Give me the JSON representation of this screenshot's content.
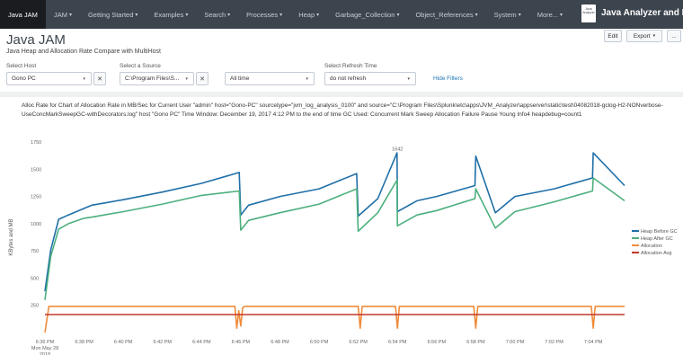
{
  "nav": {
    "items": [
      {
        "label": "Java JAM",
        "caret": ""
      },
      {
        "label": "JAM",
        "caret": "▾"
      },
      {
        "label": "Getting Started",
        "caret": "▾"
      },
      {
        "label": "Examples",
        "caret": "▾"
      },
      {
        "label": "Search",
        "caret": "▾"
      },
      {
        "label": "Processes",
        "caret": "▾"
      },
      {
        "label": "Heap",
        "caret": "▾"
      },
      {
        "label": "Garbage_Collection",
        "caret": "▾"
      },
      {
        "label": "Object_References",
        "caret": "▾"
      },
      {
        "label": "System",
        "caret": "▾"
      },
      {
        "label": "More...",
        "caret": "▾"
      }
    ],
    "logo_text": "Java Analyzer",
    "app_name": "Java Analyzer and Monitor"
  },
  "header": {
    "title": "Java JAM",
    "subtitle": "Java Heap and Allocation Rate Compare with MultiHost",
    "edit_label": "Edit",
    "export_label": "Export",
    "export_caret": "▾",
    "more_label": "..."
  },
  "filters": {
    "host": {
      "label": "Select Host",
      "value": "Gono PC",
      "caret": "▾",
      "clear": "✕"
    },
    "source": {
      "label": "Select a Source",
      "value": "C:\\Program Files\\S...",
      "caret": "▾",
      "clear": "✕"
    },
    "time": {
      "value": "All time",
      "caret": "▾"
    },
    "refresh": {
      "label": "Select Refresh Time",
      "value": "do not refresh",
      "caret": "▾"
    },
    "hide_filters": "Hide Filters"
  },
  "panel": {
    "description": "Alloc Rate for Chart of Allocation Rate in MB/Sec for Current User \"admin\" host=\"Gono-PC\" sourcetype=\"jvm_log_analysis_0100\" and source=\"C:\\Program Files\\Splunk\\etc\\apps\\JVM_Analyzer\\appserver\\static\\test\\04082018-gclog-H2-NONverbose-UseConcMarkSweepGC-withDecorators.log\" host \"Gono PC\" Time Window: December 19, 2017 4:12 PM to the end of time GC Used: Concurrent Mark Sweep Allocation Failure Pause Young Info4 heapdebug=count1"
  },
  "chart_data": {
    "type": "line",
    "ylabel": "KBytes and MB",
    "ylim": [
      0,
      1750
    ],
    "ytick_labels": [
      "250",
      "500",
      "750",
      "1000",
      "1250",
      "1500",
      "1750"
    ],
    "yticks": [
      250,
      500,
      750,
      1000,
      1250,
      1500,
      1750
    ],
    "x_tick_labels": [
      "6:36 PM\nMon May 28\n2018",
      "6:38 PM",
      "6:40 PM",
      "6:42 PM",
      "6:44 PM",
      "6:46 PM",
      "6:48 PM",
      "6:50 PM",
      "6:52 PM",
      "6:54 PM",
      "6:56 PM",
      "6:58 PM",
      "7:00 PM",
      "7:02 PM",
      "7:04 PM"
    ],
    "annotation": {
      "x": 9.0,
      "y": 1640,
      "label": "1642"
    },
    "series": [
      {
        "name": "Heap Before GC",
        "color": "#1f6fa8",
        "x": [
          0.0,
          0.15,
          0.35,
          0.6,
          1.0,
          1.2,
          2.0,
          3.0,
          4.0,
          4.96,
          5.0,
          5.2,
          6.0,
          7.0,
          7.96,
          8.0,
          8.5,
          8.99,
          9.0,
          9.5,
          10.0,
          10.98,
          11.0,
          11.5,
          12.0,
          13.0,
          13.98,
          14.0,
          14.8
        ],
        "y": [
          380,
          760,
          1040,
          1080,
          1140,
          1170,
          1220,
          1290,
          1370,
          1470,
          1080,
          1170,
          1250,
          1320,
          1460,
          1070,
          1230,
          1650,
          1110,
          1210,
          1250,
          1350,
          1620,
          1100,
          1250,
          1320,
          1420,
          1650,
          1350
        ]
      },
      {
        "name": "Heap After GC",
        "color": "#4caf7d",
        "x": [
          0.0,
          0.15,
          0.35,
          0.6,
          1.0,
          1.2,
          2.0,
          3.0,
          4.0,
          4.96,
          5.0,
          5.2,
          6.0,
          7.0,
          7.96,
          8.0,
          8.5,
          8.99,
          9.0,
          9.5,
          10.0,
          10.98,
          11.0,
          11.5,
          12.0,
          13.0,
          13.98,
          14.0,
          14.8
        ],
        "y": [
          300,
          700,
          950,
          1000,
          1050,
          1060,
          1110,
          1180,
          1260,
          1300,
          940,
          1030,
          1100,
          1180,
          1320,
          930,
          1100,
          1400,
          980,
          1080,
          1120,
          1230,
          1320,
          960,
          1110,
          1200,
          1300,
          1420,
          1210
        ]
      },
      {
        "name": "Allocation",
        "color": "#ef8c3b",
        "x": [
          0.0,
          0.1,
          4.85,
          4.9,
          4.95,
          5.0,
          5.05,
          5.1,
          8.0,
          8.05,
          8.1,
          8.2,
          8.95,
          9.0,
          9.05,
          10.95,
          11.0,
          11.05,
          13.95,
          14.0,
          14.05,
          14.8
        ],
        "y": [
          0,
          240,
          240,
          40,
          200,
          60,
          230,
          240,
          240,
          40,
          240,
          240,
          240,
          40,
          240,
          240,
          40,
          240,
          240,
          40,
          240,
          240
        ]
      },
      {
        "name": "Allocation Avg",
        "color": "#c1392b",
        "x": [
          0.0,
          14.8
        ],
        "y": [
          165,
          165
        ]
      }
    ]
  }
}
